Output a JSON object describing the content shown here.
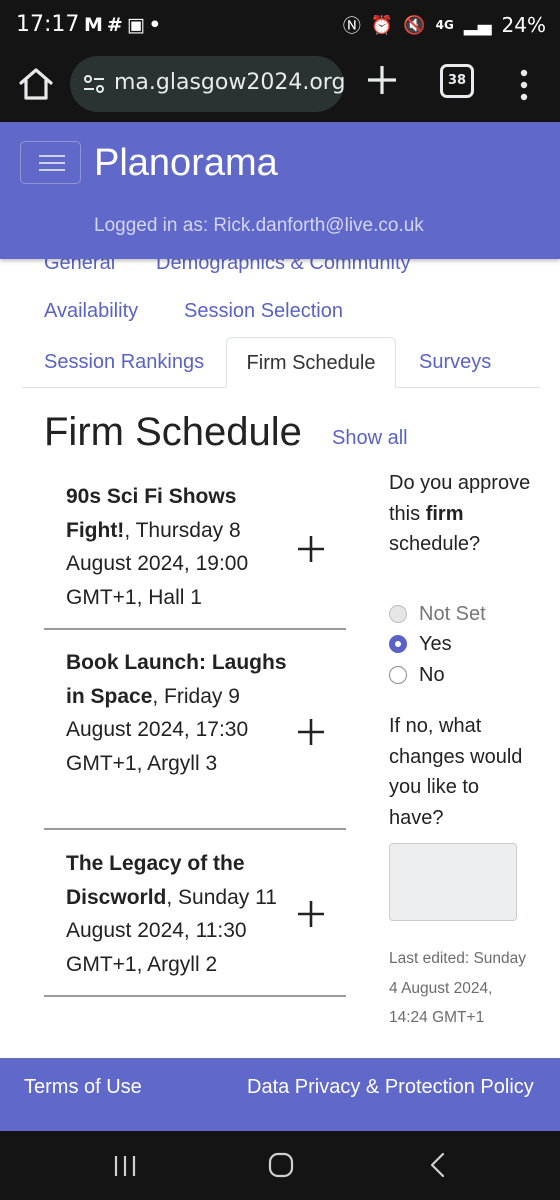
{
  "status_bar": {
    "time": "17:17",
    "left_icons": [
      "gmail-icon",
      "slack-icon",
      "voicemail-icon",
      "dot-icon"
    ],
    "right_icons": [
      "nfc-icon",
      "alarm-icon",
      "mute-icon",
      "network-4g-icon",
      "signal-icon"
    ],
    "network": "4G",
    "battery": "24%"
  },
  "browser": {
    "url": "ma.glasgow2024.org",
    "tab_count": "38"
  },
  "navbar": {
    "brand": "Planorama",
    "logged_in": "Logged in as: Rick.danforth@live.co.uk"
  },
  "tabs": {
    "general": "General",
    "demographics": "Demographics & Community",
    "availability": "Availability",
    "session_selection": "Session Selection",
    "session_rankings": "Session Rankings",
    "firm_schedule": "Firm Schedule",
    "surveys": "Surveys"
  },
  "main": {
    "title": "Firm Schedule",
    "show_all": "Show all",
    "items": [
      {
        "title": "90s Sci Fi Shows Fight!",
        "detail": ", Thursday 8 August 2024, 19:00 GMT+1, Hall 1"
      },
      {
        "title": "Book Launch: Laughs in Space",
        "detail": ", Friday 9 August 2024, 17:30 GMT+1, Argyll 3"
      },
      {
        "title": "The Legacy of the Discworld",
        "detail": ", Sunday 11 August 2024, 11:30 GMT+1, Argyll 2"
      }
    ]
  },
  "approval": {
    "question_before": "Do you approve this ",
    "question_bold": "firm",
    "question_after": " schedule?",
    "options": [
      "Not Set",
      "Yes",
      "No"
    ],
    "selected": "Yes",
    "changes_question": "If no, what changes would you like to have?",
    "last_edited": "Last edited: Sunday 4 August 2024, 14:24 GMT+1"
  },
  "footer": {
    "terms": "Terms of Use",
    "privacy": "Data Privacy & Protection Policy"
  },
  "colors": {
    "brand": "#6068c9",
    "link": "#5a63c4",
    "system_bar": "#141414"
  }
}
